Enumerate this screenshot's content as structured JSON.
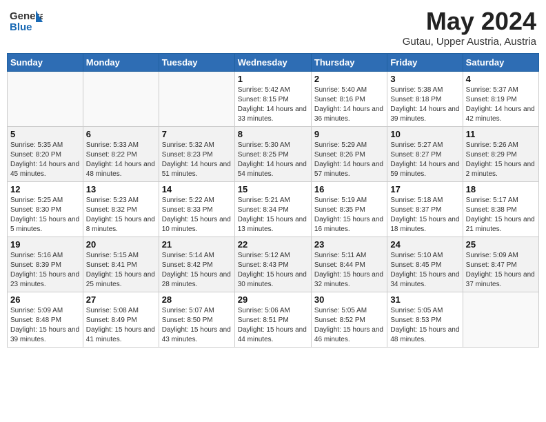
{
  "header": {
    "logo_general": "General",
    "logo_blue": "Blue",
    "month_title": "May 2024",
    "subtitle": "Gutau, Upper Austria, Austria"
  },
  "weekdays": [
    "Sunday",
    "Monday",
    "Tuesday",
    "Wednesday",
    "Thursday",
    "Friday",
    "Saturday"
  ],
  "weeks": [
    [
      {
        "day": "",
        "info": ""
      },
      {
        "day": "",
        "info": ""
      },
      {
        "day": "",
        "info": ""
      },
      {
        "day": "1",
        "info": "Sunrise: 5:42 AM\nSunset: 8:15 PM\nDaylight: 14 hours and 33 minutes."
      },
      {
        "day": "2",
        "info": "Sunrise: 5:40 AM\nSunset: 8:16 PM\nDaylight: 14 hours and 36 minutes."
      },
      {
        "day": "3",
        "info": "Sunrise: 5:38 AM\nSunset: 8:18 PM\nDaylight: 14 hours and 39 minutes."
      },
      {
        "day": "4",
        "info": "Sunrise: 5:37 AM\nSunset: 8:19 PM\nDaylight: 14 hours and 42 minutes."
      }
    ],
    [
      {
        "day": "5",
        "info": "Sunrise: 5:35 AM\nSunset: 8:20 PM\nDaylight: 14 hours and 45 minutes."
      },
      {
        "day": "6",
        "info": "Sunrise: 5:33 AM\nSunset: 8:22 PM\nDaylight: 14 hours and 48 minutes."
      },
      {
        "day": "7",
        "info": "Sunrise: 5:32 AM\nSunset: 8:23 PM\nDaylight: 14 hours and 51 minutes."
      },
      {
        "day": "8",
        "info": "Sunrise: 5:30 AM\nSunset: 8:25 PM\nDaylight: 14 hours and 54 minutes."
      },
      {
        "day": "9",
        "info": "Sunrise: 5:29 AM\nSunset: 8:26 PM\nDaylight: 14 hours and 57 minutes."
      },
      {
        "day": "10",
        "info": "Sunrise: 5:27 AM\nSunset: 8:27 PM\nDaylight: 14 hours and 59 minutes."
      },
      {
        "day": "11",
        "info": "Sunrise: 5:26 AM\nSunset: 8:29 PM\nDaylight: 15 hours and 2 minutes."
      }
    ],
    [
      {
        "day": "12",
        "info": "Sunrise: 5:25 AM\nSunset: 8:30 PM\nDaylight: 15 hours and 5 minutes."
      },
      {
        "day": "13",
        "info": "Sunrise: 5:23 AM\nSunset: 8:32 PM\nDaylight: 15 hours and 8 minutes."
      },
      {
        "day": "14",
        "info": "Sunrise: 5:22 AM\nSunset: 8:33 PM\nDaylight: 15 hours and 10 minutes."
      },
      {
        "day": "15",
        "info": "Sunrise: 5:21 AM\nSunset: 8:34 PM\nDaylight: 15 hours and 13 minutes."
      },
      {
        "day": "16",
        "info": "Sunrise: 5:19 AM\nSunset: 8:35 PM\nDaylight: 15 hours and 16 minutes."
      },
      {
        "day": "17",
        "info": "Sunrise: 5:18 AM\nSunset: 8:37 PM\nDaylight: 15 hours and 18 minutes."
      },
      {
        "day": "18",
        "info": "Sunrise: 5:17 AM\nSunset: 8:38 PM\nDaylight: 15 hours and 21 minutes."
      }
    ],
    [
      {
        "day": "19",
        "info": "Sunrise: 5:16 AM\nSunset: 8:39 PM\nDaylight: 15 hours and 23 minutes."
      },
      {
        "day": "20",
        "info": "Sunrise: 5:15 AM\nSunset: 8:41 PM\nDaylight: 15 hours and 25 minutes."
      },
      {
        "day": "21",
        "info": "Sunrise: 5:14 AM\nSunset: 8:42 PM\nDaylight: 15 hours and 28 minutes."
      },
      {
        "day": "22",
        "info": "Sunrise: 5:12 AM\nSunset: 8:43 PM\nDaylight: 15 hours and 30 minutes."
      },
      {
        "day": "23",
        "info": "Sunrise: 5:11 AM\nSunset: 8:44 PM\nDaylight: 15 hours and 32 minutes."
      },
      {
        "day": "24",
        "info": "Sunrise: 5:10 AM\nSunset: 8:45 PM\nDaylight: 15 hours and 34 minutes."
      },
      {
        "day": "25",
        "info": "Sunrise: 5:09 AM\nSunset: 8:47 PM\nDaylight: 15 hours and 37 minutes."
      }
    ],
    [
      {
        "day": "26",
        "info": "Sunrise: 5:09 AM\nSunset: 8:48 PM\nDaylight: 15 hours and 39 minutes."
      },
      {
        "day": "27",
        "info": "Sunrise: 5:08 AM\nSunset: 8:49 PM\nDaylight: 15 hours and 41 minutes."
      },
      {
        "day": "28",
        "info": "Sunrise: 5:07 AM\nSunset: 8:50 PM\nDaylight: 15 hours and 43 minutes."
      },
      {
        "day": "29",
        "info": "Sunrise: 5:06 AM\nSunset: 8:51 PM\nDaylight: 15 hours and 44 minutes."
      },
      {
        "day": "30",
        "info": "Sunrise: 5:05 AM\nSunset: 8:52 PM\nDaylight: 15 hours and 46 minutes."
      },
      {
        "day": "31",
        "info": "Sunrise: 5:05 AM\nSunset: 8:53 PM\nDaylight: 15 hours and 48 minutes."
      },
      {
        "day": "",
        "info": ""
      }
    ]
  ]
}
